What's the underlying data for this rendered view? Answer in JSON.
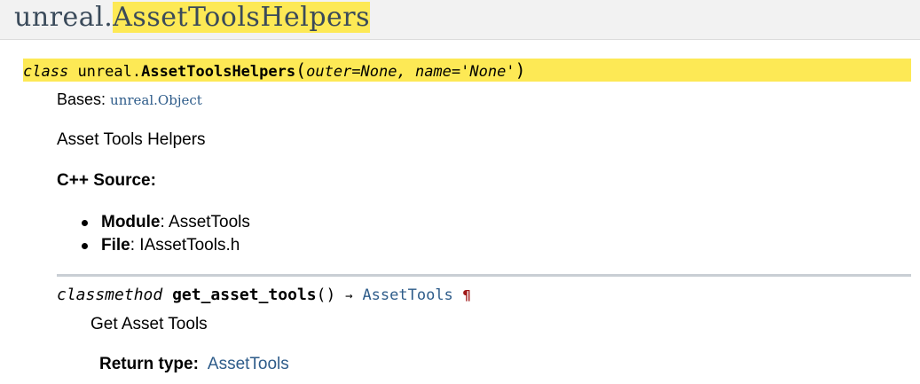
{
  "page_header": {
    "prefix": "unreal.",
    "highlight": "AssetToolsHelpers"
  },
  "signature": {
    "keyword": "class",
    "module": "unreal.",
    "name": "AssetToolsHelpers",
    "open_paren": "(",
    "params": "outer=None, name='None'",
    "close_paren": ")"
  },
  "bases": {
    "label": "Bases:",
    "link": "unreal.Object"
  },
  "description": "Asset Tools Helpers",
  "cpp_source": {
    "heading": "C++ Source:",
    "items": [
      {
        "key": "Module",
        "sep": ": ",
        "value": "AssetTools"
      },
      {
        "key": "File",
        "sep": ": ",
        "value": "IAssetTools.h"
      }
    ]
  },
  "method": {
    "keyword": "classmethod",
    "name": "get_asset_tools",
    "parens": "()",
    "arrow": "→",
    "return_link": "AssetTools",
    "pilcrow": "¶",
    "description": "Get Asset Tools",
    "return_type_label": "Return type:",
    "return_type_value": "AssetTools"
  },
  "colors": {
    "highlight": "#fde955",
    "link": "#2e5c8a",
    "title": "#3a4a5a",
    "pilcrow": "#a01818",
    "separator": "#c9ced4"
  }
}
